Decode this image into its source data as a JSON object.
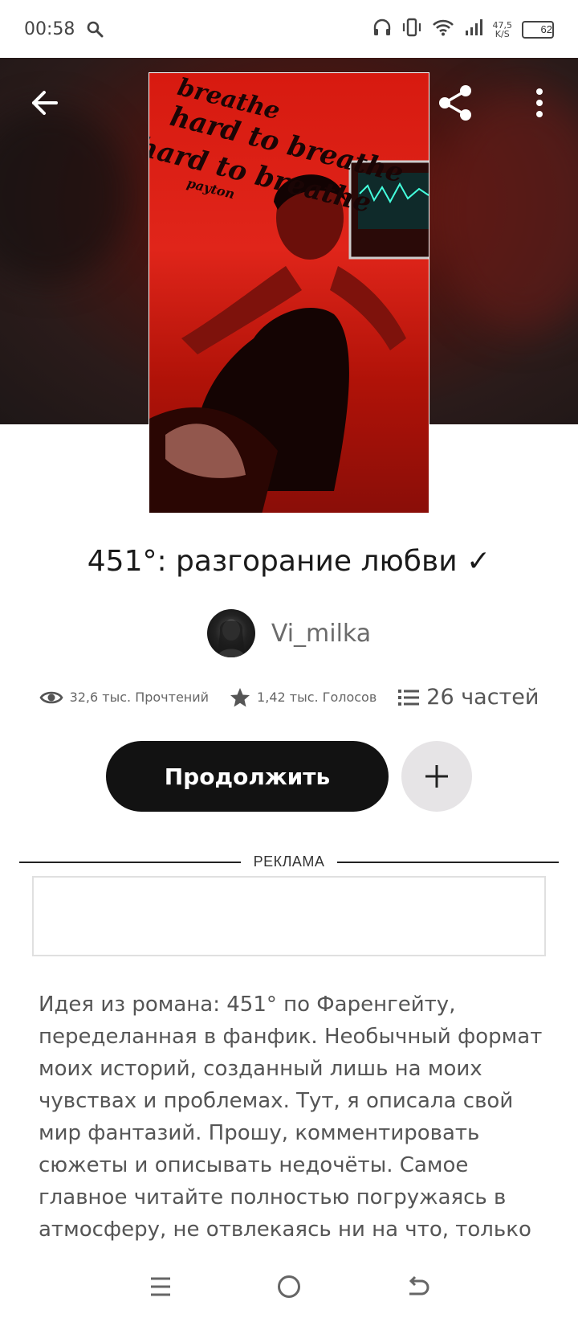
{
  "status_bar": {
    "time": "00:58",
    "net_speed_value": "47,5",
    "net_speed_unit": "K/S",
    "battery": "62",
    "battery_level": 0.62,
    "icons": [
      "search-icon",
      "headphones-icon",
      "vibrate-icon",
      "wifi-icon",
      "signal-icon",
      "battery-icon"
    ]
  },
  "header": {
    "icons": [
      "back-arrow-icon",
      "share-icon",
      "more-vertical-icon"
    ]
  },
  "cover": {
    "text_lines": [
      "breathe",
      "hard to breathe",
      "hard to breathe",
      "payton"
    ]
  },
  "book": {
    "title": "451°: разгорание любви ✓",
    "author": "Vi_milka"
  },
  "stats": {
    "reads": "32,6 тыс. Прочтений",
    "votes": "1,42 тыс. Голосов",
    "parts": "26 частей"
  },
  "actions": {
    "continue_label": "Продолжить",
    "add_icon": "plus-icon"
  },
  "ad": {
    "label": "РЕКЛАМА"
  },
  "description": "Идея из романа: 451° по Фаренгейту, переделанная в фанфик. Необычный формат моих историй, созданный лишь на моих чувствах и проблемах. Тут, я описала свой мир фантазий. Прошу, комментировать сюжеты и описывать недочёты. Самое главное читайте полностью погружаясь в атмосферу, не отвлекаясь ни на что, только тогда, вы",
  "nav_bar": {
    "icons": [
      "menu-icon",
      "home-circle-icon",
      "back-icon"
    ]
  },
  "colors": {
    "button_dark": "#121212",
    "add_button_bg": "#e6e4e6",
    "cover_red": "#e0251a"
  }
}
